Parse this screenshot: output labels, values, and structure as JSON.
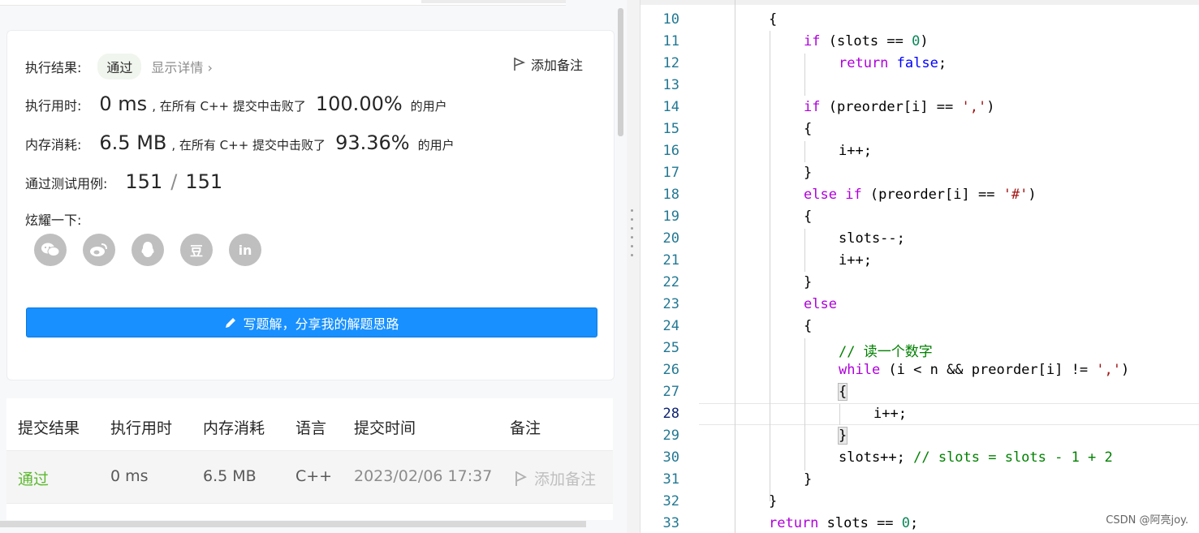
{
  "result": {
    "label": "执行结果:",
    "status": "通过",
    "detail": "显示详情 ›",
    "note": "添加备注"
  },
  "runtime": {
    "label": "执行用时:",
    "value": "0 ms",
    "mid": ", 在所有 C++ 提交中击败了",
    "percent": "100.00%",
    "suffix": "的用户"
  },
  "memory": {
    "label": "内存消耗:",
    "value": "6.5 MB",
    "mid": ", 在所有 C++ 提交中击败了",
    "percent": "93.36%",
    "suffix": "的用户"
  },
  "tests": {
    "label": "通过测试用例:",
    "passed": "151",
    "sep": "/",
    "total": "151"
  },
  "share": {
    "label": "炫耀一下:",
    "icons": [
      "wechat-icon",
      "weibo-icon",
      "qq-icon",
      "douban-icon",
      "linkedin-icon"
    ],
    "douban_glyph": "豆",
    "linkedin_glyph": "in"
  },
  "write_solution": "写题解，分享我的解题思路",
  "table": {
    "headers": [
      "提交结果",
      "执行用时",
      "内存消耗",
      "语言",
      "提交时间",
      "备注"
    ],
    "row": {
      "status": "通过",
      "runtime": "0 ms",
      "memory": "6.5 MB",
      "language": "C++",
      "time": "2023/02/06 17:37",
      "note": "添加备注"
    }
  },
  "code_lines": [
    {
      "n": "10"
    },
    {
      "n": "11"
    },
    {
      "n": "12"
    },
    {
      "n": "13"
    },
    {
      "n": "14"
    },
    {
      "n": "15"
    },
    {
      "n": "16"
    },
    {
      "n": "17"
    },
    {
      "n": "18"
    },
    {
      "n": "19"
    },
    {
      "n": "20"
    },
    {
      "n": "21"
    },
    {
      "n": "22"
    },
    {
      "n": "23"
    },
    {
      "n": "24"
    },
    {
      "n": "25"
    },
    {
      "n": "26"
    },
    {
      "n": "27"
    },
    {
      "n": "28"
    },
    {
      "n": "29"
    },
    {
      "n": "30"
    },
    {
      "n": "31"
    },
    {
      "n": "32"
    },
    {
      "n": "33"
    }
  ],
  "code": {
    "l10": "{",
    "l11_kw": "if",
    "l11_a": " (slots == ",
    "l11_num": "0",
    "l11_b": ")",
    "l12_kw": "return",
    "l12_val": "false",
    "l12_end": ";",
    "l14_kw": "if",
    "l14_a": " (preorder[i] == ",
    "l14_str": "','",
    "l14_b": ")",
    "l15": "{",
    "l16": "i++;",
    "l17": "}",
    "l18_kw1": "else",
    "l18_kw2": "if",
    "l18_a": " (preorder[i] == ",
    "l18_str": "'#'",
    "l18_b": ")",
    "l19": "{",
    "l20": "slots--;",
    "l21": "i++;",
    "l22": "}",
    "l23_kw": "else",
    "l24": "{",
    "l25_com": "// 读一个数字",
    "l26_kw": "while",
    "l26_a": " (i < n && preorder[i] != ",
    "l26_str": "','",
    "l26_b": ")",
    "l27": "{",
    "l28": "i++;",
    "l29": "}",
    "l30_a": "slots++; ",
    "l30_com": "// slots = slots - 1 + 2",
    "l31": "}",
    "l32": "}",
    "l33_kw": "return",
    "l33_a": " slots == ",
    "l33_num": "0",
    "l33_b": ";"
  },
  "watermark": "CSDN @阿亮joy."
}
